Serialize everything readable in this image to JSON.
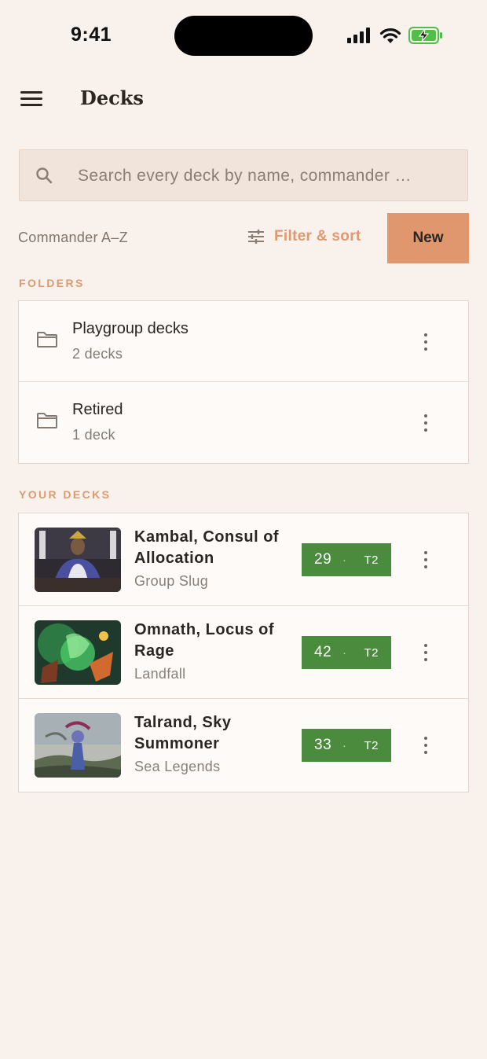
{
  "status_bar": {
    "time": "9:41"
  },
  "header": {
    "title": "Decks"
  },
  "search": {
    "placeholder": "Search every deck by name, commander …"
  },
  "toolbar": {
    "sort_label": "Commander A–Z",
    "filter_label": "Filter & sort",
    "new_label": "New",
    "accent_color": "#e0976e"
  },
  "folders": {
    "heading": "FOLDERS",
    "items": [
      {
        "name": "Playgroup decks",
        "count": "2 decks"
      },
      {
        "name": "Retired",
        "count": "1 deck"
      }
    ]
  },
  "decks": {
    "heading": "YOUR DECKS",
    "badge_color": "#4b8b3e",
    "items": [
      {
        "name": "Kambal, Consul of Allocation",
        "theme": "Group Slug",
        "count": "29",
        "sep": "·",
        "tier": "T2",
        "art": "kambal-commander-art"
      },
      {
        "name": "Omnath, Locus of Rage",
        "theme": "Landfall",
        "count": "42",
        "sep": "·",
        "tier": "T2",
        "art": "omnath-commander-art"
      },
      {
        "name": "Talrand, Sky Summoner",
        "theme": "Sea Legends",
        "count": "33",
        "sep": "·",
        "tier": "T2",
        "art": "talrand-commander-art"
      }
    ]
  }
}
